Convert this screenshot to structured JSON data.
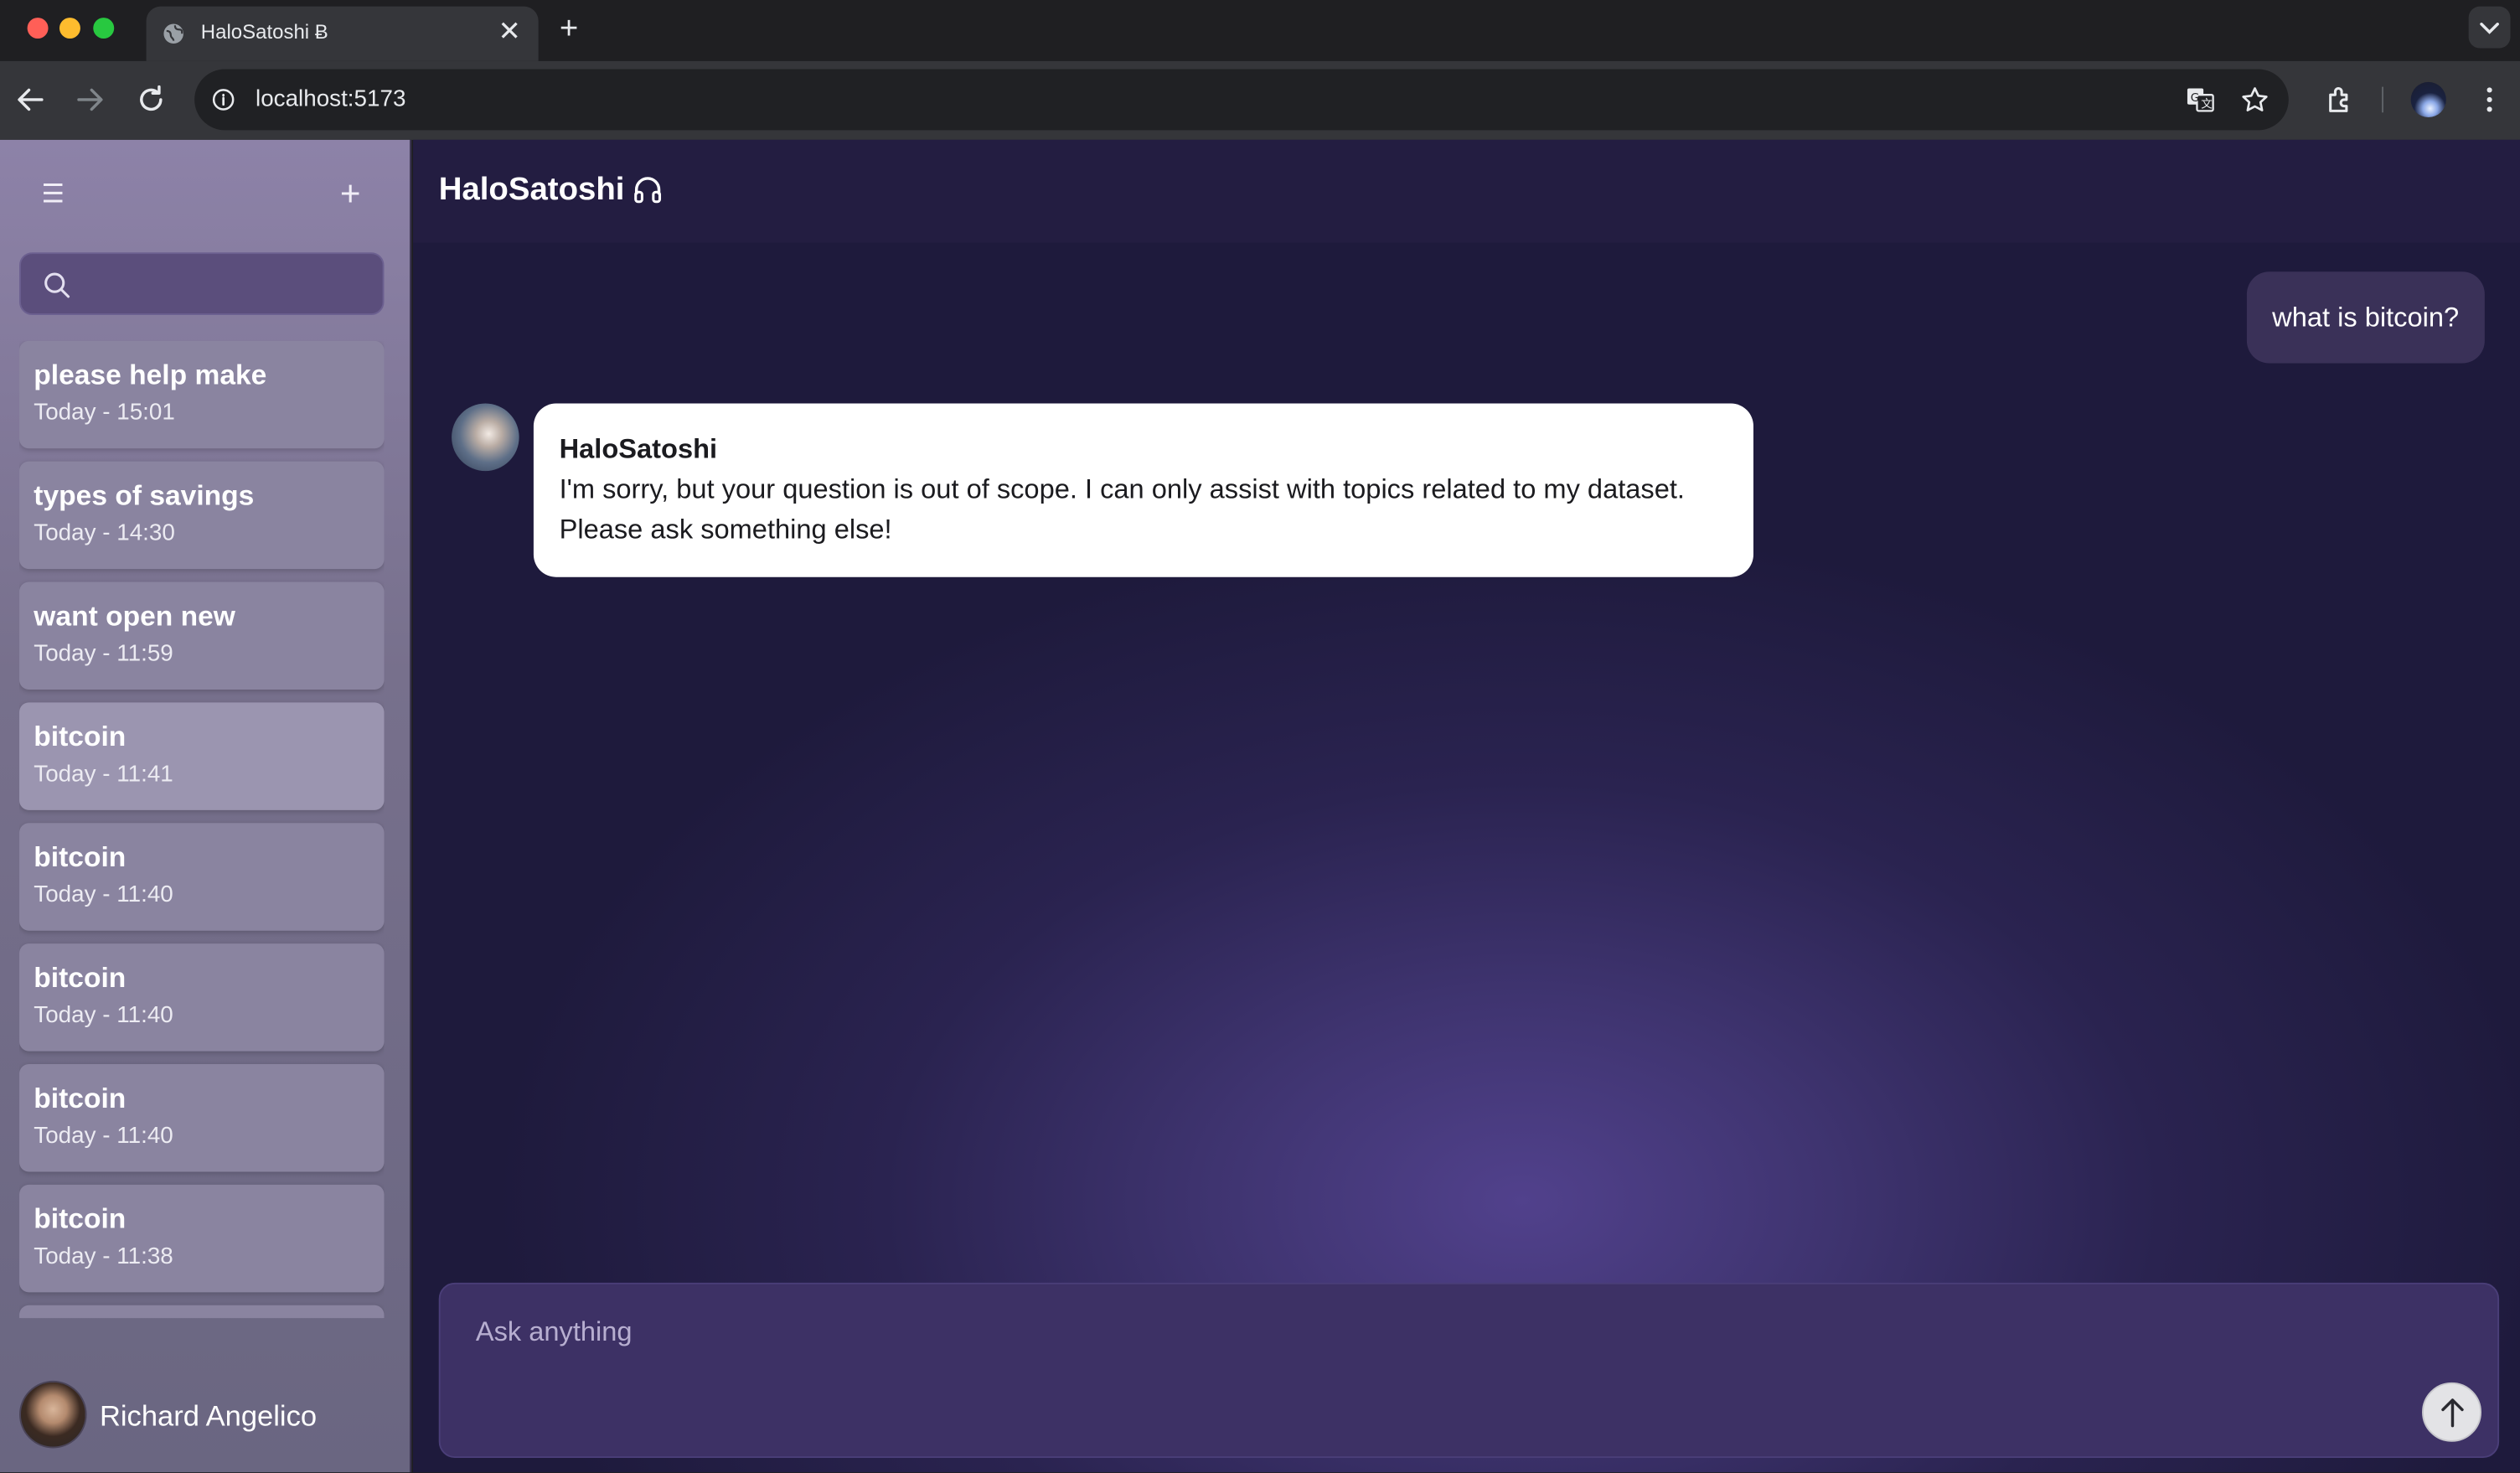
{
  "browser": {
    "tab_title": "HaloSatoshi Ƀ",
    "url": "localhost:5173",
    "icons": [
      "globe-icon",
      "close-icon",
      "plus-icon",
      "chevron-down-icon",
      "back-arrow-icon",
      "forward-arrow-icon",
      "reload-icon",
      "info-icon",
      "translate-icon",
      "star-icon",
      "extensions-icon",
      "kebab-menu-icon"
    ]
  },
  "sidebar": {
    "menu_icon": "hamburger-icon",
    "new_chat_icon": "plus-icon",
    "search": {
      "placeholder": "",
      "value": "",
      "icon": "search-icon"
    },
    "chats": [
      {
        "title": "please help make",
        "time": "Today - 15:01"
      },
      {
        "title": "types of savings",
        "time": "Today - 14:30"
      },
      {
        "title": "want open new",
        "time": "Today - 11:59"
      },
      {
        "title": "bitcoin",
        "time": "Today - 11:41",
        "active": true
      },
      {
        "title": "bitcoin",
        "time": "Today - 11:40"
      },
      {
        "title": "bitcoin",
        "time": "Today - 11:40"
      },
      {
        "title": "bitcoin",
        "time": "Today - 11:40"
      },
      {
        "title": "bitcoin",
        "time": "Today - 11:38"
      }
    ],
    "user": {
      "name": "Richard Angelico"
    }
  },
  "main": {
    "header": {
      "title": "HaloSatoshi",
      "icon": "headphones-icon"
    },
    "messages": {
      "user": "what is bitcoin?",
      "bot_name": "HaloSatoshi",
      "bot_line_1": "I'm sorry, but your question is out of scope. I can only assist with topics related to my dataset.",
      "bot_line_2": "Please ask something else!"
    },
    "composer": {
      "placeholder": "Ask anything",
      "send_icon": "arrow-up-icon"
    }
  },
  "colors": {
    "sidebar_top": "#8d82a8",
    "main_bg": "#1e1a3c",
    "glow": "#51418c",
    "bot_bubble": "#ffffff",
    "user_bubble": "#3a3158"
  }
}
